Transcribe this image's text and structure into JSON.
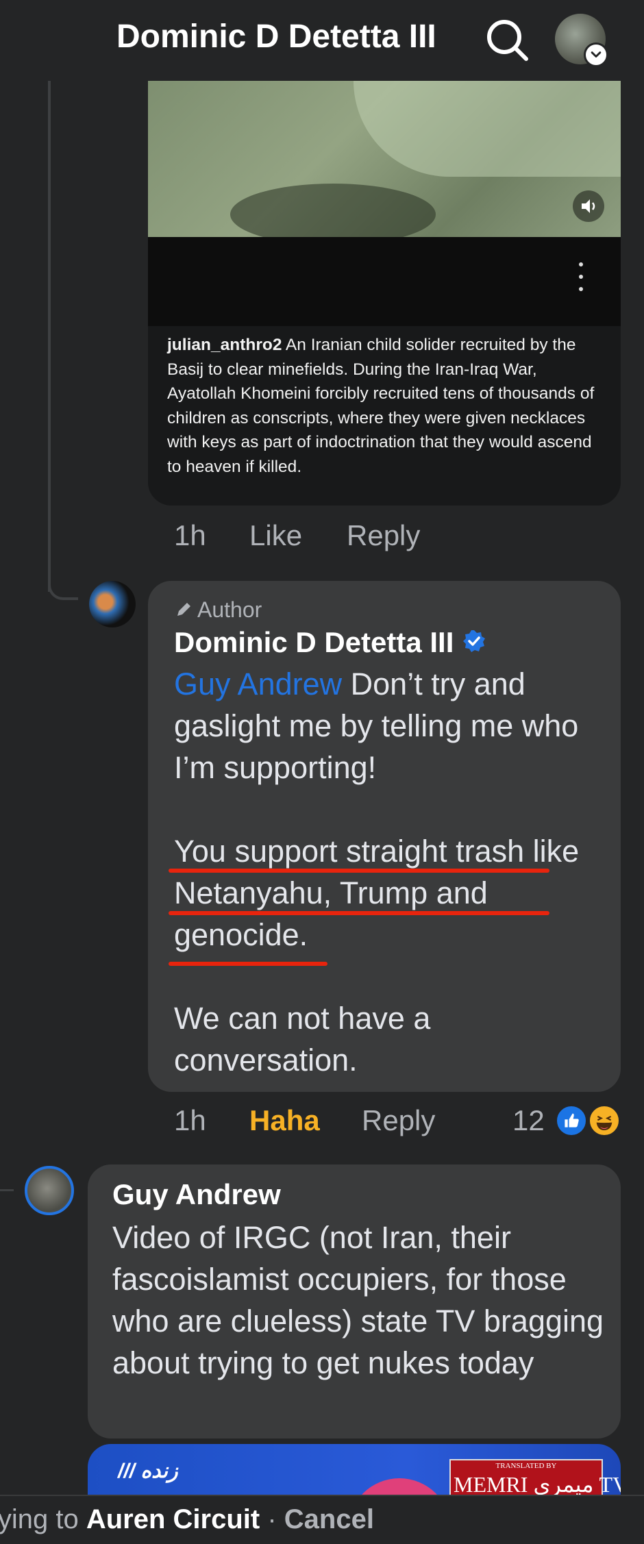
{
  "header": {
    "title": "Dominic D Detetta III"
  },
  "media_post": {
    "caption_user": "julian_anthro2",
    "caption_text": "An Iranian child solider recruited by the Basij to clear minefields. During the Iran-Iraq War, Ayatollah Khomeini forcibly recruited tens of thousands of children as conscripts, where they were given necklaces with keys as part of indoctrination that they would ascend to heaven if killed."
  },
  "comment_actions_1": {
    "time": "1h",
    "like": "Like",
    "reply": "Reply"
  },
  "comment_dominic": {
    "author_badge": "Author",
    "name": "Dominic D Detetta III",
    "mention": "Guy Andrew",
    "text_1": "Don’t try and gaslight me by telling me who I’m supporting!",
    "text_2": "You support straight trash like Netanyahu, Trump and genocide.",
    "text_3": "We can not have a conversation.",
    "time": "1h",
    "reaction_label": "Haha",
    "reply": "Reply",
    "reaction_count": "12"
  },
  "comment_guy": {
    "name": "Guy Andrew",
    "text": "Video of IRGC (not Iran, their fascoislamist occupiers, for those who are clueless) state TV bragging about trying to get nukes today"
  },
  "video_preview": {
    "logo_text": "/// زنده",
    "watermark_small": "TRANSLATED BY",
    "watermark": "MEMRI ميمري TV"
  },
  "reply_bar": {
    "prefix": "lying to ",
    "target": "Auren Circuit",
    "separator": " · ",
    "cancel": "Cancel"
  },
  "colors": {
    "background": "#242526",
    "bubble": "#3a3b3c",
    "mention": "#2374e1",
    "haha": "#f7b125",
    "underline": "#e8240d"
  }
}
